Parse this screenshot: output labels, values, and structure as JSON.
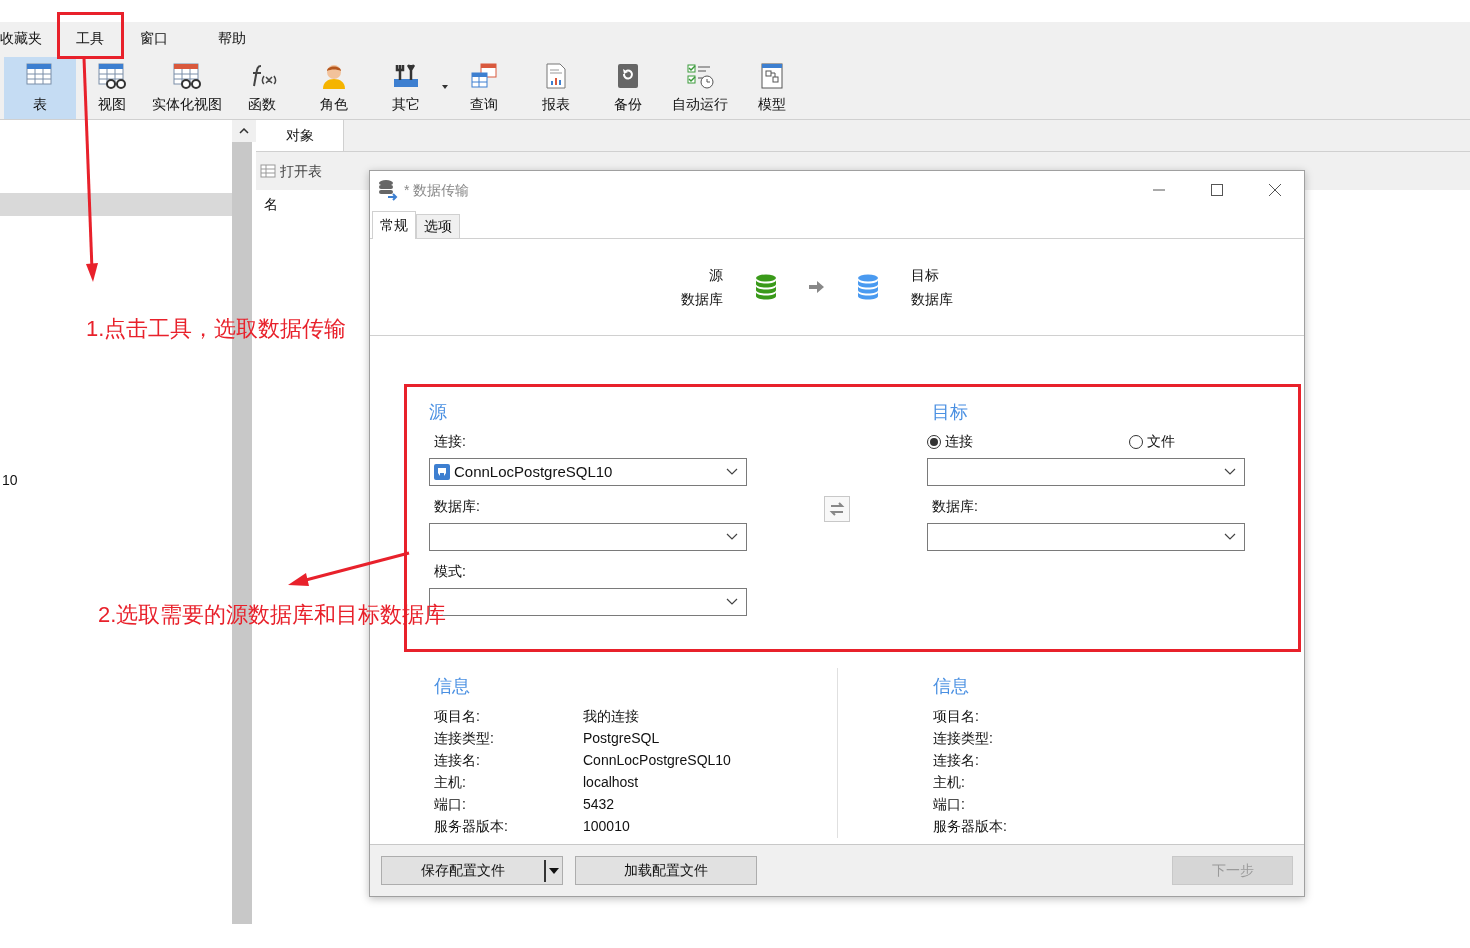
{
  "menu": [
    {
      "label": "收藏夹",
      "selected": false
    },
    {
      "label": "工具",
      "selected": false
    },
    {
      "label": "窗口",
      "selected": false
    },
    {
      "label": "帮助",
      "selected": false
    }
  ],
  "toolbar": [
    {
      "label": "表",
      "kind": "table",
      "selected": true
    },
    {
      "label": "视图",
      "kind": "view",
      "selected": false
    },
    {
      "label": "实体化视图",
      "kind": "mview",
      "selected": false
    },
    {
      "label": "函数",
      "kind": "function",
      "selected": false
    },
    {
      "label": "角色",
      "kind": "user",
      "selected": false
    },
    {
      "label": "其它",
      "kind": "tools",
      "selected": false,
      "dropdown": true
    },
    {
      "label": "查询",
      "kind": "query",
      "selected": false
    },
    {
      "label": "报表",
      "kind": "report",
      "selected": false
    },
    {
      "label": "备份",
      "kind": "backup",
      "selected": false
    },
    {
      "label": "自动运行",
      "kind": "schedule",
      "selected": false
    },
    {
      "label": "模型",
      "kind": "model",
      "selected": false
    }
  ],
  "left_panel": {
    "item_text": "10"
  },
  "object_tab": {
    "label": "对象"
  },
  "object_toolbar": [
    {
      "label": "打开表"
    }
  ],
  "object_list": {
    "column": "名"
  },
  "dialog": {
    "title": "* 数据传输",
    "tabs": [
      {
        "label": "常规",
        "selected": true
      },
      {
        "label": "选项",
        "selected": false
      }
    ],
    "flow": {
      "source_lines": [
        "源",
        "数据库"
      ],
      "target_lines": [
        "目标",
        "数据库"
      ]
    },
    "source": {
      "heading": "源",
      "fields": [
        {
          "label": "连接:",
          "value": "ConnLocPostgreSQL10",
          "icon": true
        },
        {
          "label": "数据库:",
          "icon": false
        },
        {
          "label": "模式:",
          "icon": false
        }
      ]
    },
    "target": {
      "heading": "目标",
      "options": [
        {
          "label": "连接",
          "selected": true
        },
        {
          "label": "文件",
          "selected": false
        }
      ],
      "fields": [
        {
          "label": "数据库:"
        }
      ]
    },
    "source_info": {
      "heading": "信息",
      "rows": [
        {
          "key": "项目名:",
          "value": "我的连接"
        },
        {
          "key": "连接类型:",
          "value": "PostgreSQL"
        },
        {
          "key": "连接名:",
          "value": "ConnLocPostgreSQL10"
        },
        {
          "key": "主机:",
          "value": "localhost"
        },
        {
          "key": "端口:",
          "value": "5432"
        },
        {
          "key": "服务器版本:",
          "value": "100010"
        }
      ]
    },
    "target_info": {
      "heading": "信息",
      "rows": [
        {
          "key": "项目名:"
        },
        {
          "key": "连接类型:"
        },
        {
          "key": "连接名:"
        },
        {
          "key": "主机:"
        },
        {
          "key": "端口:"
        },
        {
          "key": "服务器版本:"
        }
      ]
    },
    "buttons": [
      {
        "label": "保存配置文件",
        "kind": "split",
        "disabled": false
      },
      {
        "label": "加载配置文件",
        "kind": "plain",
        "disabled": false
      },
      {
        "label": "下一步",
        "kind": "plain",
        "disabled": true
      }
    ]
  },
  "annotations": [
    {
      "text": "1.点击工具，选取数据传输"
    },
    {
      "text": "2.选取需要的源数据库和目标数据库"
    }
  ]
}
